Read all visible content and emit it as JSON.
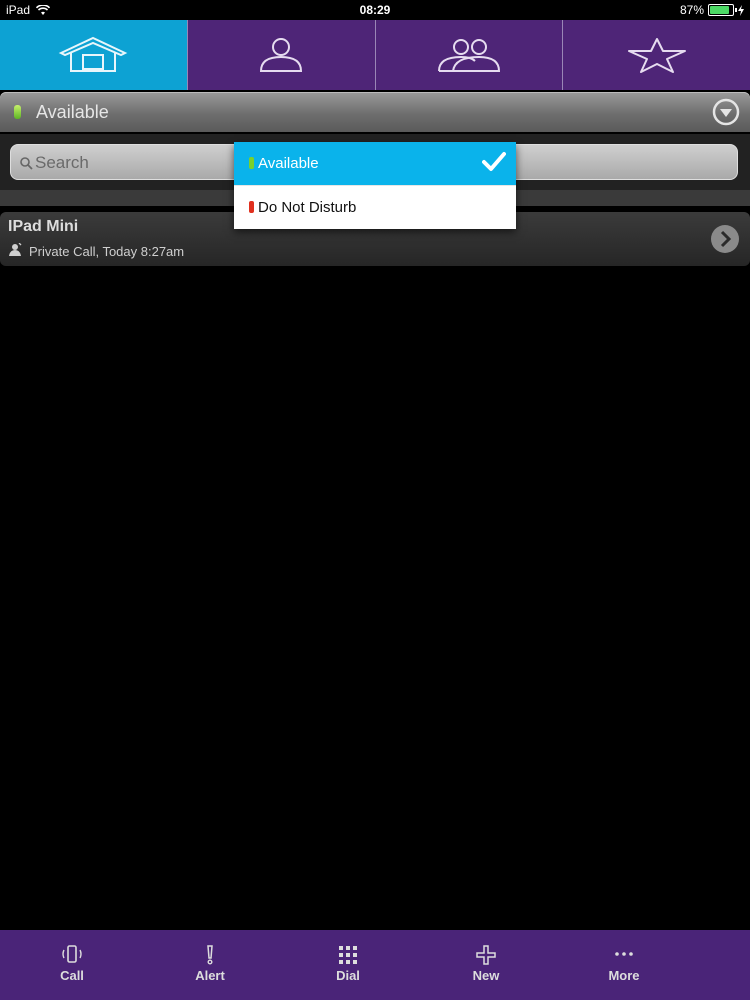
{
  "statusbar": {
    "device": "iPad",
    "time": "08:29",
    "battery": "87%",
    "battery_level": 0.87
  },
  "tabs": [
    {
      "icon": "home-icon",
      "active": true
    },
    {
      "icon": "contact-icon",
      "active": false
    },
    {
      "icon": "group-icon",
      "active": false
    },
    {
      "icon": "star-icon",
      "active": false
    }
  ],
  "presence": {
    "label": "Available",
    "indicator_color": "#5db624"
  },
  "search": {
    "placeholder": "Search",
    "value": ""
  },
  "dropdown": {
    "options": [
      {
        "label": "Available",
        "selected": true,
        "color": "#7ad12b"
      },
      {
        "label": "Do Not Disturb",
        "selected": false,
        "color": "#e0301e"
      }
    ]
  },
  "calls": [
    {
      "title": "IPad Mini",
      "detail": "Private Call, Today 8:27am"
    }
  ],
  "bottombar": {
    "call": "Call",
    "alert": "Alert",
    "dial": "Dial",
    "new": "New",
    "more": "More"
  },
  "colors": {
    "accent": "#0da2d3",
    "brand": "#4e2577"
  }
}
